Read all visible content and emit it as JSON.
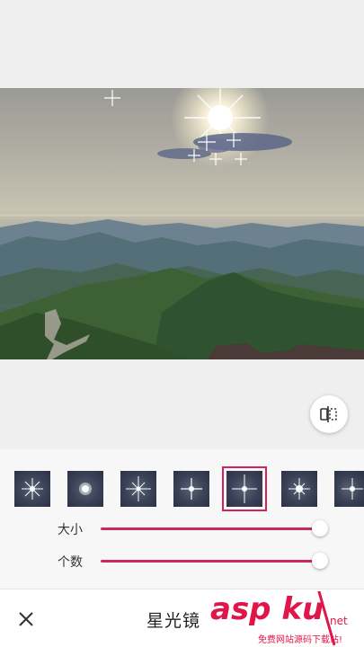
{
  "filters": [
    {
      "name": "star-filter-1",
      "selected": false
    },
    {
      "name": "star-filter-2",
      "selected": false
    },
    {
      "name": "star-filter-3",
      "selected": false
    },
    {
      "name": "star-filter-4",
      "selected": false
    },
    {
      "name": "star-filter-5",
      "selected": true
    },
    {
      "name": "star-filter-6",
      "selected": false
    },
    {
      "name": "star-filter-7",
      "selected": false
    }
  ],
  "sliders": {
    "size": {
      "label": "大小",
      "value": 1.0
    },
    "count": {
      "label": "个数",
      "value": 1.0
    }
  },
  "bottom_bar": {
    "title": "星光镜",
    "close_icon": "close-icon"
  },
  "watermark": {
    "main": "asp ku",
    "net": "net",
    "sub": "免费网站源码下载站!"
  },
  "colors": {
    "accent": "#c9295c",
    "watermark": "#e0154a"
  }
}
